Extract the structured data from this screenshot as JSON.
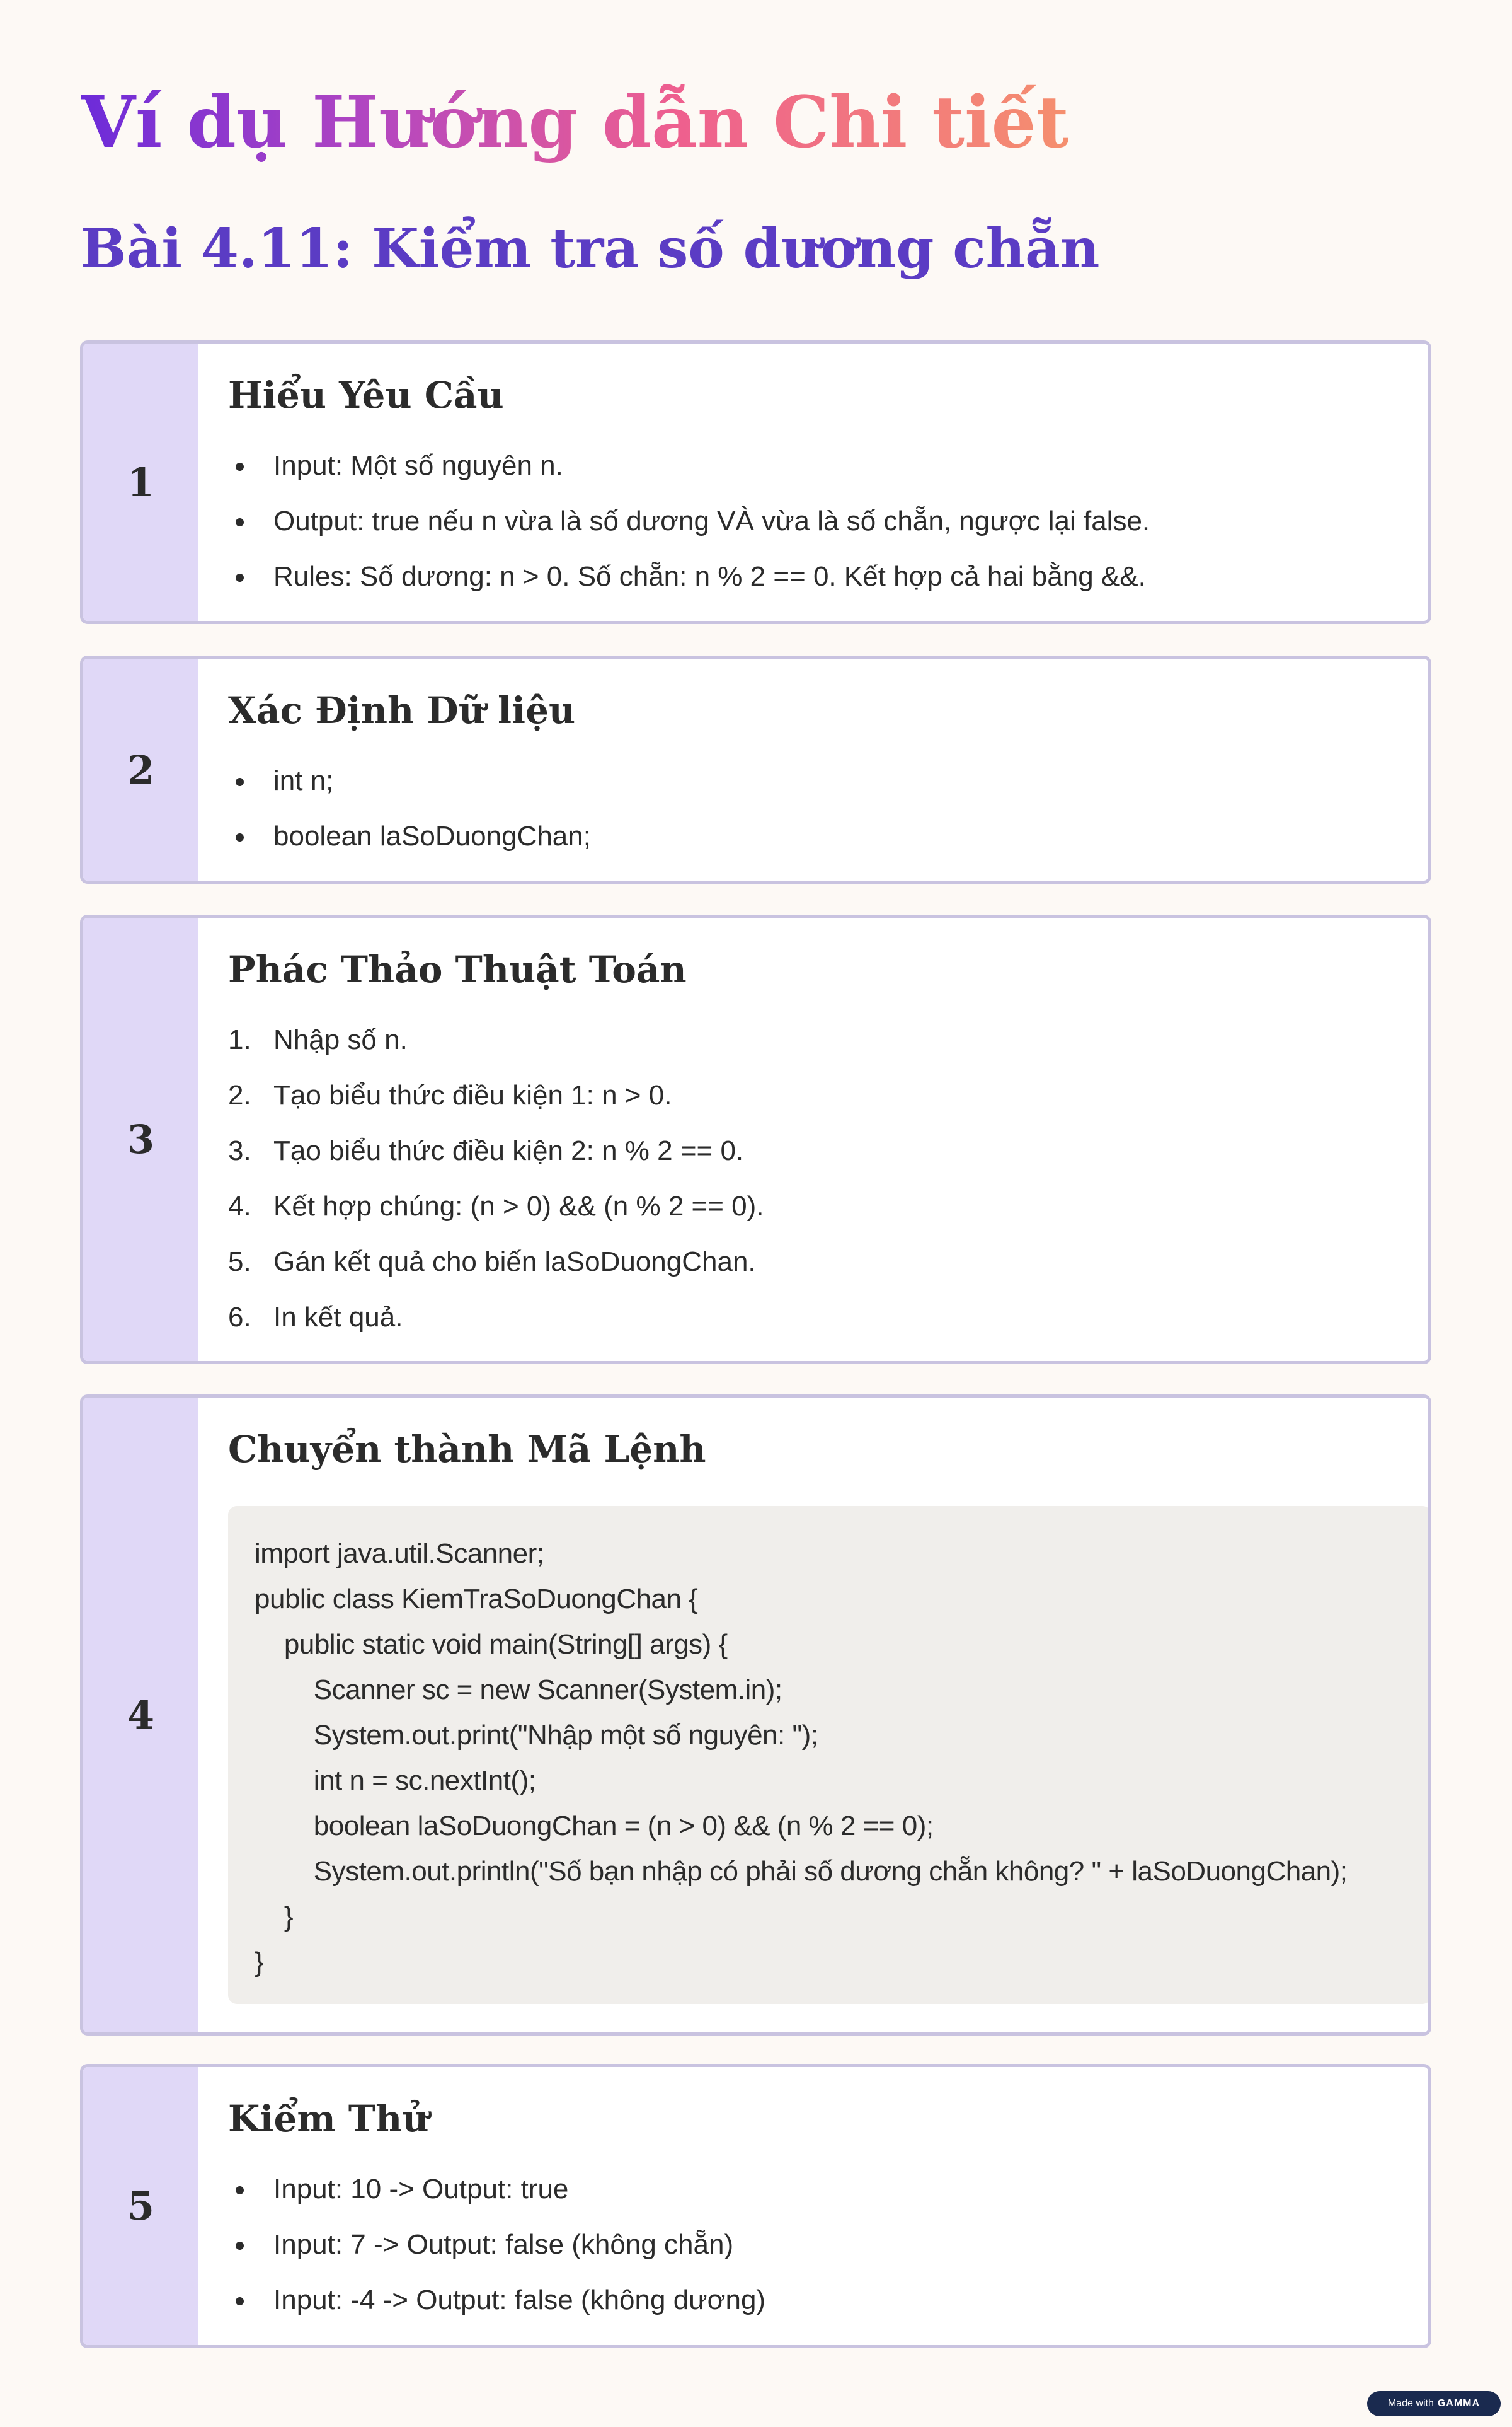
{
  "title": "Ví dụ Hướng dẫn Chi tiết",
  "subtitle": "Bài 4.11: Kiểm tra số dương chẵn",
  "steps": [
    {
      "number": "1",
      "heading": "Hiểu Yêu Cầu",
      "items": [
        "Input: Một số nguyên n.",
        "Output: true nếu n vừa là số dương VÀ vừa là số chẵn, ngược lại false.",
        "Rules: Số dương: n > 0. Số chẵn: n % 2 == 0. Kết hợp cả hai bằng &&."
      ]
    },
    {
      "number": "2",
      "heading": "Xác Định Dữ liệu",
      "items": [
        "int n;",
        "boolean laSoDuongChan;"
      ]
    },
    {
      "number": "3",
      "heading": "Phác Thảo Thuật Toán",
      "ordered_items": [
        {
          "n": "1.",
          "text": "Nhập số n."
        },
        {
          "n": "2.",
          "text": "Tạo biểu thức điều kiện 1: n > 0."
        },
        {
          "n": "3.",
          "text": "Tạo biểu thức điều kiện 2: n % 2 == 0."
        },
        {
          "n": "4.",
          "text": "Kết hợp chúng: (n > 0) && (n % 2 == 0)."
        },
        {
          "n": "5.",
          "text": "Gán kết quả cho biến laSoDuongChan."
        },
        {
          "n": "6.",
          "text": "In kết quả."
        }
      ]
    },
    {
      "number": "4",
      "heading": "Chuyển thành Mã Lệnh",
      "code_lines": [
        "import java.util.Scanner;",
        "public class KiemTraSoDuongChan {",
        "    public static void main(String[] args) {",
        "        Scanner sc = new Scanner(System.in);",
        "        System.out.print(\"Nhập một số nguyên: \");",
        "        int n = sc.nextInt();",
        "        boolean laSoDuongChan = (n > 0) && (n % 2 == 0);",
        "        System.out.println(\"Số bạn nhập có phải số dương chẵn không? \" + laSoDuongChan);",
        "    }",
        "}"
      ]
    },
    {
      "number": "5",
      "heading": "Kiểm Thử",
      "items": [
        "Input: 10 -> Output: true",
        "Input: 7 -> Output: false (không chẵn)",
        "Input: -4 -> Output: false (không dương)"
      ]
    }
  ],
  "badge": {
    "prefix": "Made with",
    "brand": "GAMMA"
  }
}
